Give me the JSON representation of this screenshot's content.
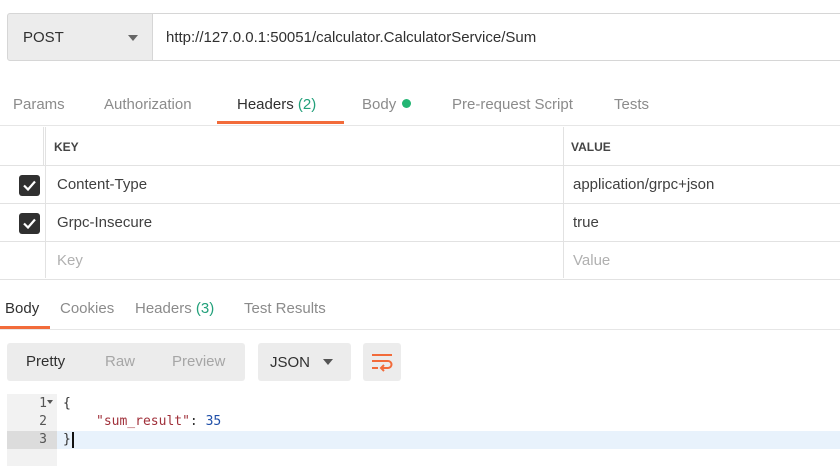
{
  "request": {
    "method": "POST",
    "url": "http://127.0.0.1:50051/calculator.CalculatorService/Sum"
  },
  "request_tabs": {
    "params": "Params",
    "authorization": "Authorization",
    "headers": "Headers",
    "headers_count": "(2)",
    "body": "Body",
    "prerequest": "Pre-request Script",
    "tests": "Tests"
  },
  "headers_table": {
    "key_header": "KEY",
    "value_header": "VALUE",
    "rows": [
      {
        "key": "Content-Type",
        "value": "application/grpc+json",
        "checked": true
      },
      {
        "key": "Grpc-Insecure",
        "value": "true",
        "checked": true
      }
    ],
    "placeholder_key": "Key",
    "placeholder_value": "Value"
  },
  "response_tabs": {
    "body": "Body",
    "cookies": "Cookies",
    "headers": "Headers",
    "headers_count": "(3)",
    "test_results": "Test Results"
  },
  "response_toolbar": {
    "pretty": "Pretty",
    "raw": "Raw",
    "preview": "Preview",
    "format": "JSON"
  },
  "response_body": {
    "line_numbers": [
      "1",
      "2",
      "3"
    ],
    "line1": "{",
    "key": "\"sum_result\"",
    "colon": ": ",
    "value": "35",
    "line3": "}"
  },
  "colors": {
    "accent": "#f26b3a",
    "count_green": "#22a07a",
    "dot_green": "#22b573"
  }
}
